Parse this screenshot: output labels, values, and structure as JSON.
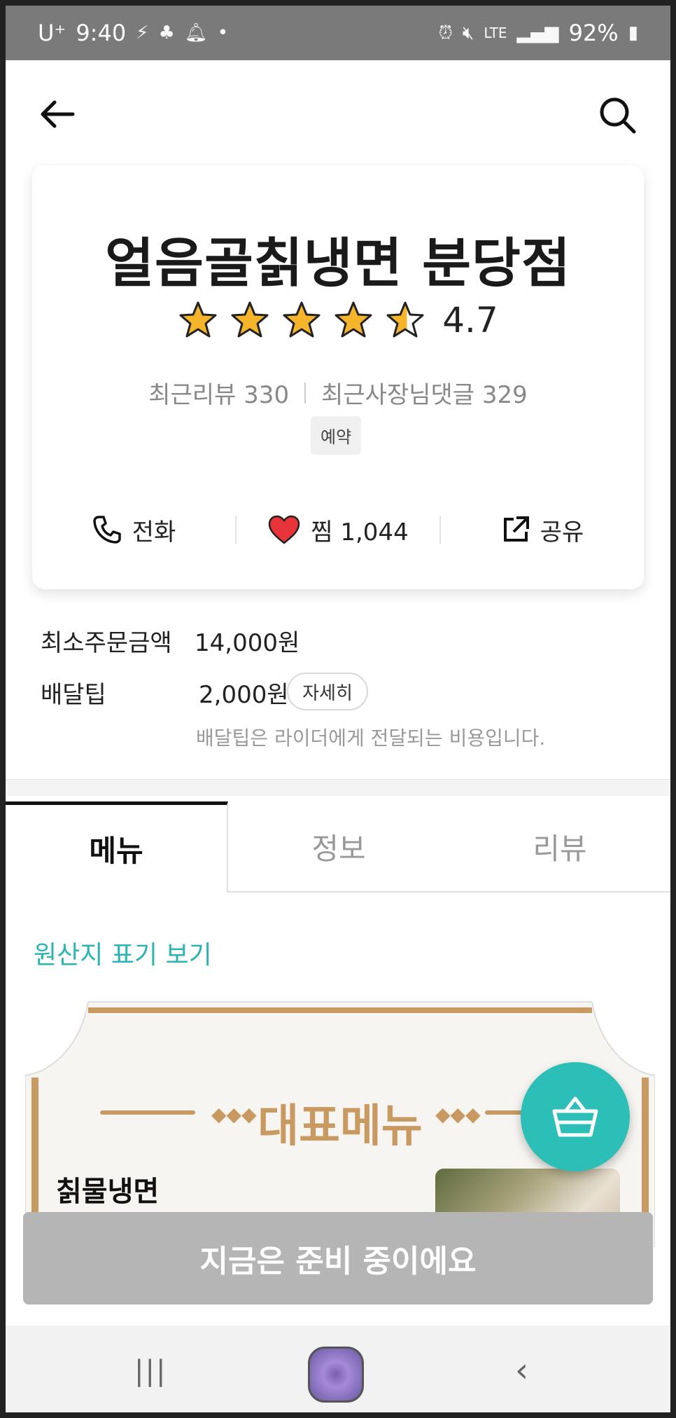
{
  "status_bar": {
    "carrier": "U⁺",
    "time": "9:40",
    "network": "LTE",
    "battery": "92%"
  },
  "store": {
    "name": "얼음골칡냉면 분당점",
    "rating": "4.7",
    "rating_stars": 4.5,
    "recent_reviews": "최근리뷰 330",
    "owner_replies": "최근사장님댓글 329",
    "badge": "예약"
  },
  "actions": {
    "call": "전화",
    "like": "찜 1,044",
    "share": "공유"
  },
  "order_info": {
    "min_order_label": "최소주문금액",
    "min_order_value": "14,000원",
    "delivery_tip_label": "배달팁",
    "delivery_tip_value": "2,000원",
    "detail_button": "자세히",
    "tip_note": "배달팁은 라이더에게 전달되는 비용입니다."
  },
  "tabs": [
    {
      "label": "메뉴",
      "active": true
    },
    {
      "label": "정보",
      "active": false
    },
    {
      "label": "리뷰",
      "active": false
    }
  ],
  "origin_link": "원산지 표기 보기",
  "banner": {
    "title": "대표메뉴",
    "item_name": "칡물냉면"
  },
  "order_bar": "지금은 준비 중이에요",
  "colors": {
    "accent": "#2bbfb8",
    "link": "#2bb5b0",
    "banner_gold": "#c89a62",
    "disabled": "#b5b5b5"
  }
}
